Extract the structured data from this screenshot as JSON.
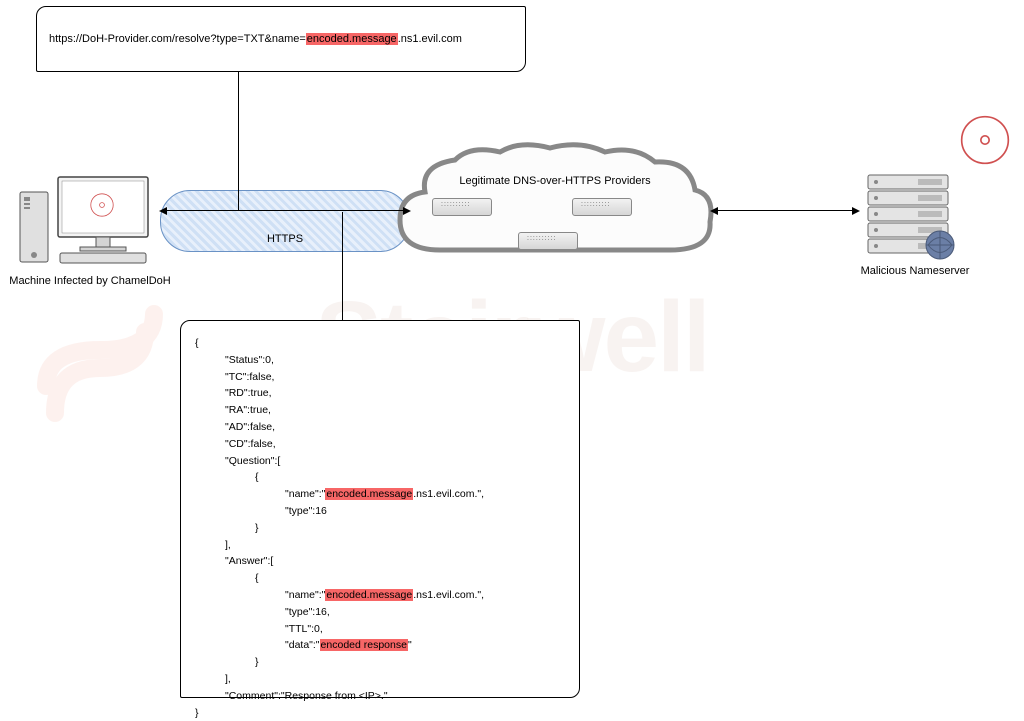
{
  "watermark": "Stairwell",
  "url": {
    "prefix": "https://DoH-Provider.com/resolve?type=TXT&name=",
    "highlighted": "encoded.message",
    "suffix": ".ns1.evil.com"
  },
  "computer_label": "Machine Infected by ChamelDoH",
  "https_label": "HTTPS",
  "cloud_label": "Legitimate DNS-over-HTTPS Providers",
  "server_label": "Malicious Nameserver",
  "json": {
    "status": "\"Status\":0,",
    "tc": "\"TC\":false,",
    "rd": "\"RD\":true,",
    "ra": "\"RA\":true,",
    "ad": "\"AD\":false,",
    "cd": "\"CD\":false,",
    "question_key": "\"Question\":[",
    "q_name_pre": "\"name\":\"",
    "q_name_hl": "encoded.message",
    "q_name_suf": ".ns1.evil.com.\",",
    "q_type": "\"type\":16",
    "answer_key": "\"Answer\":[",
    "a_name_pre": "\"name\":\"",
    "a_name_hl": "encoded.message",
    "a_name_suf": ".ns1.evil.com.\",",
    "a_type": "\"type\":16,",
    "a_ttl": "\"TTL\":0,",
    "a_data_pre": "\"data\":\"",
    "a_data_hl": "encoded response",
    "a_data_suf": "\"",
    "comment": "\"Comment\":\"Response from <IP>.\""
  }
}
